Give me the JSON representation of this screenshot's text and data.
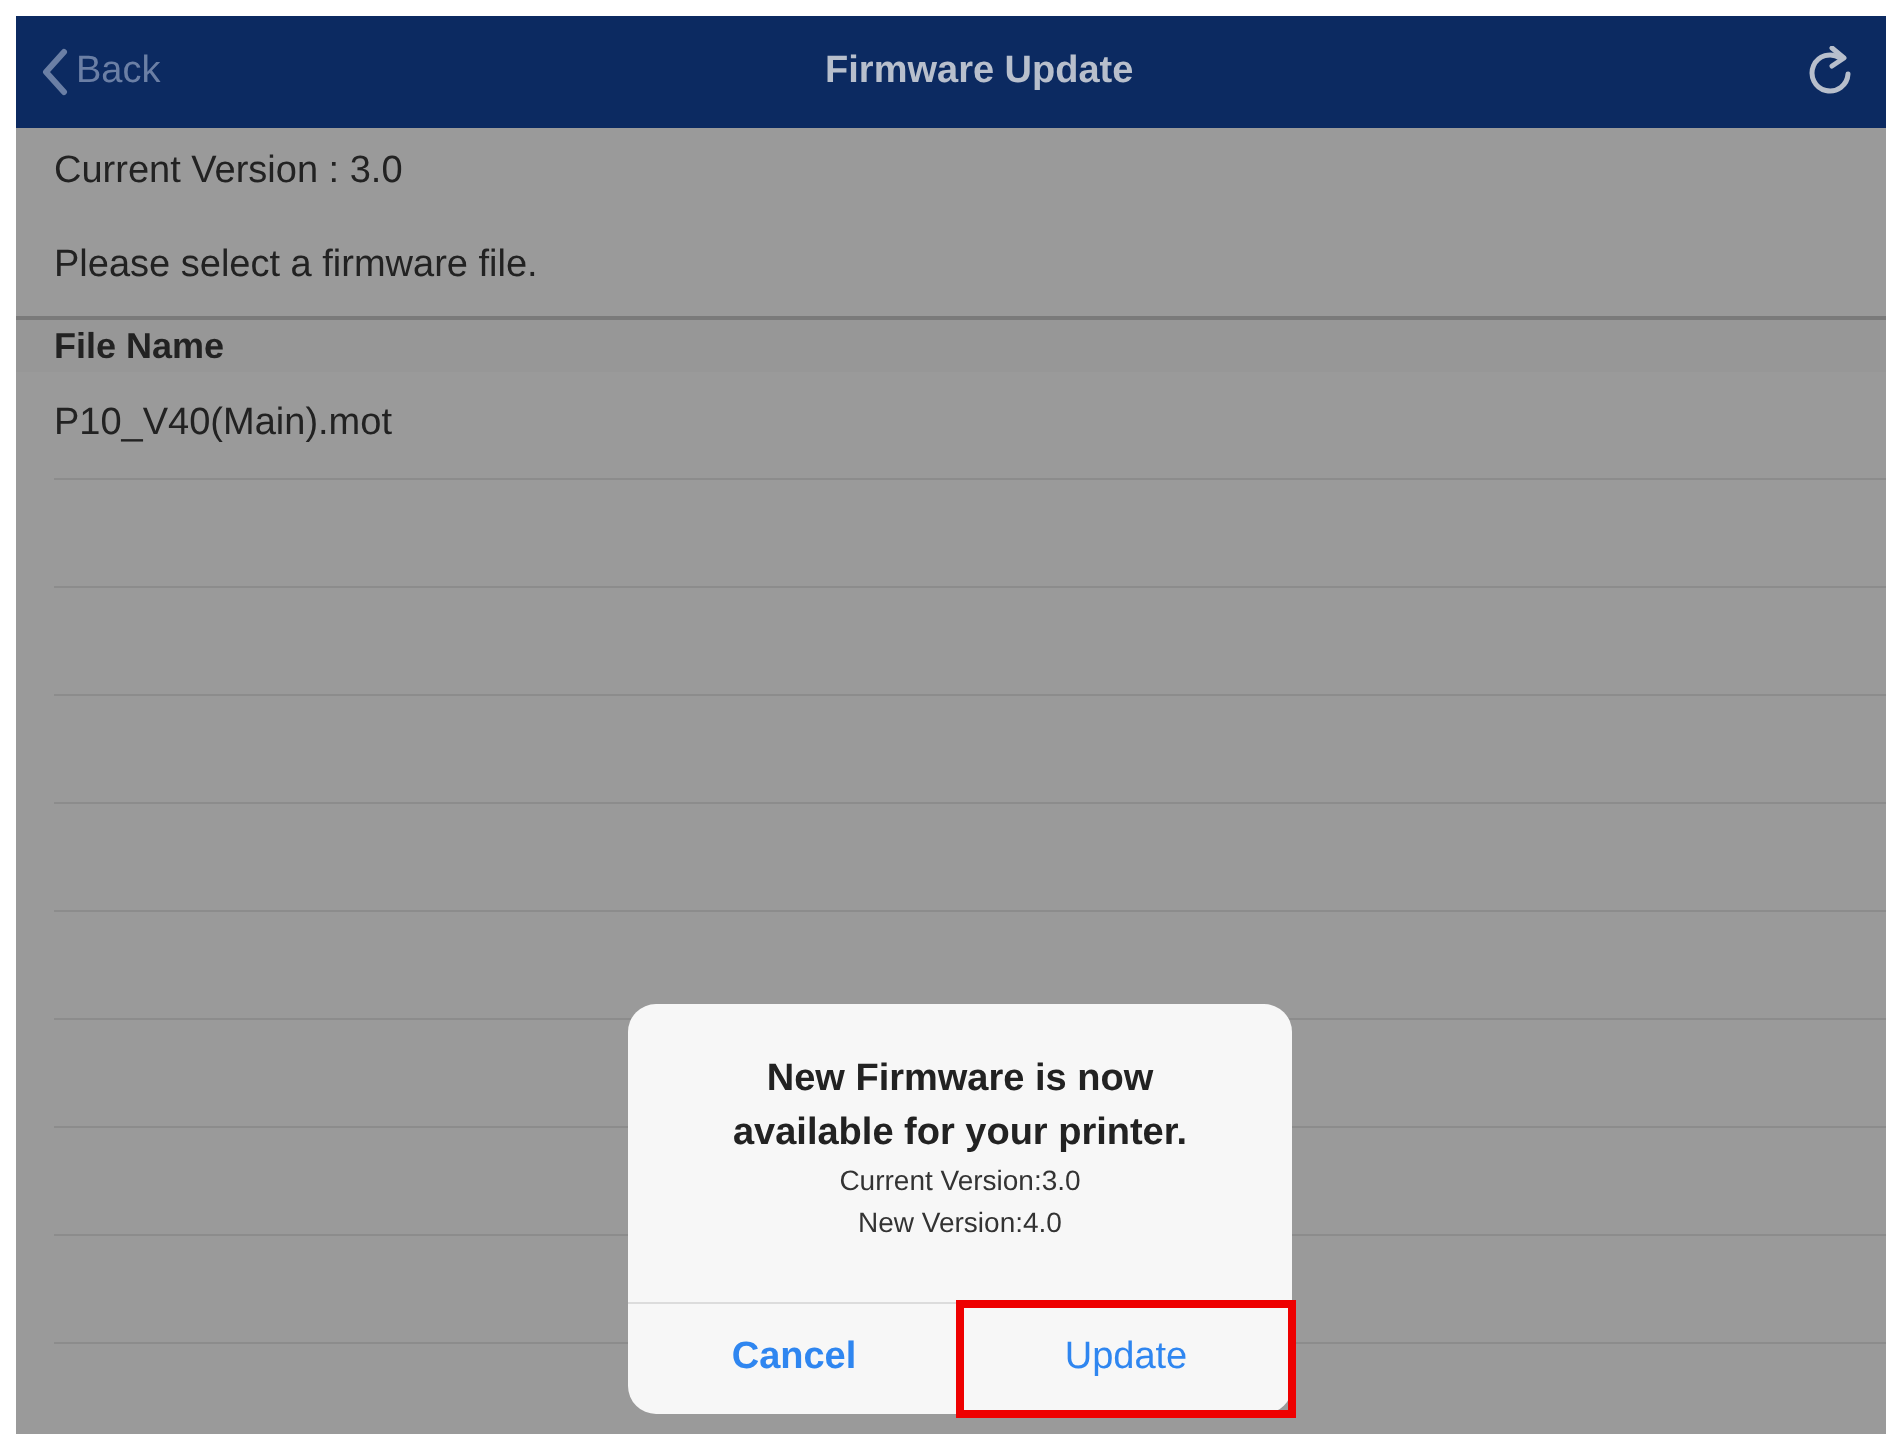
{
  "nav_bar": {
    "back_label": "Back",
    "title": "Firmware Update"
  },
  "current_version": "Current Version : 3.0",
  "instruction": "Please select a firmware file.",
  "table": {
    "columns": [
      "File Name"
    ],
    "rows": [
      {
        "file_name": "P10_V40(Main).mot"
      }
    ]
  },
  "dialog": {
    "title": "New Firmware is now available for your printer.",
    "lines": [
      "Current Version:3.0",
      "New Version:4.0"
    ],
    "buttons": [
      {
        "label": "Cancel",
        "kind": "cancel",
        "highlighted": false
      },
      {
        "label": "Update",
        "kind": "default",
        "highlighted": true
      }
    ]
  }
}
